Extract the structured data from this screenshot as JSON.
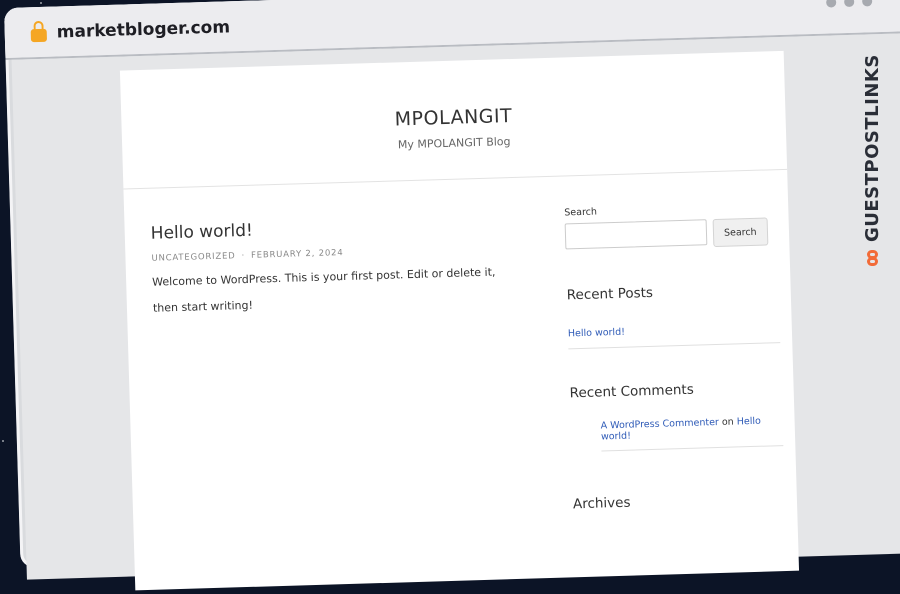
{
  "browser": {
    "url": "marketbloger.com"
  },
  "site": {
    "title": "MPOLANGIT",
    "tagline": "My MPOLANGIT Blog"
  },
  "post": {
    "title": "Hello world!",
    "category": "UNCATEGORIZED",
    "separator": "·",
    "date": "FEBRUARY 2, 2024",
    "body": "Welcome to WordPress. This is your first post. Edit or delete it, then start writing!"
  },
  "sidebar": {
    "search_label": "Search",
    "search_placeholder": "",
    "search_button": "Search",
    "recent_posts_title": "Recent Posts",
    "recent_posts": [
      "Hello world!"
    ],
    "recent_comments_title": "Recent Comments",
    "recent_comment": {
      "author": "A WordPress Commenter",
      "on": "on",
      "post": "Hello world!"
    },
    "archives_title": "Archives"
  },
  "watermark": {
    "text": "GUESTPOSTLINKS",
    "accent_color": "#f26b38"
  }
}
